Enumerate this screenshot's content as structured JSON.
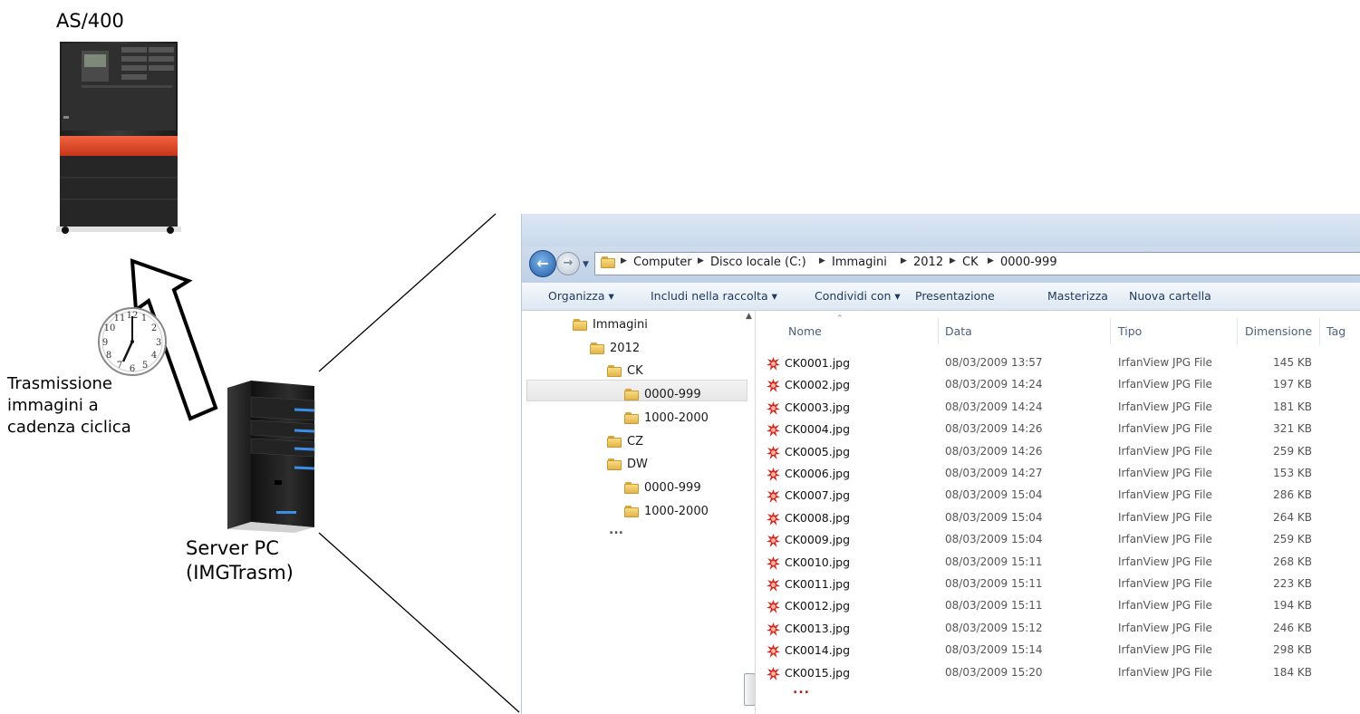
{
  "diagram": {
    "as400_label": "AS/400",
    "transmission_label": [
      "Trasmissione",
      "immagini a",
      "cadenza ciclica"
    ],
    "server_label": [
      "Server PC",
      "(IMGTrasm)"
    ]
  },
  "explorer": {
    "breadcrumb": [
      "Computer",
      "Disco locale (C:)",
      "Immagini",
      "2012",
      "CK",
      "0000-999"
    ],
    "toolbar": [
      "Organizza",
      "Includi nella raccolta",
      "Condividi con",
      "Presentazione",
      "Masterizza",
      "Nuova cartella"
    ],
    "tree": [
      {
        "label": "Immagini",
        "level": 0
      },
      {
        "label": "2012",
        "level": 1
      },
      {
        "label": "CK",
        "level": 2
      },
      {
        "label": "0000-999",
        "level": 3,
        "selected": true
      },
      {
        "label": "1000-2000",
        "level": 3
      },
      {
        "label": "CZ",
        "level": 2
      },
      {
        "label": "DW",
        "level": 2
      },
      {
        "label": "0000-999",
        "level": 3
      },
      {
        "label": "1000-2000",
        "level": 3
      }
    ],
    "tree_more": "...",
    "columns": [
      "Nome",
      "Data",
      "Tipo",
      "Dimensione",
      "Tag"
    ],
    "files": [
      {
        "name": "CK0001.jpg",
        "date": "08/03/2009 13:57",
        "type": "IrfanView JPG File",
        "size": "145 KB"
      },
      {
        "name": "CK0002.jpg",
        "date": "08/03/2009 14:24",
        "type": "IrfanView JPG File",
        "size": "197 KB"
      },
      {
        "name": "CK0003.jpg",
        "date": "08/03/2009 14:24",
        "type": "IrfanView JPG File",
        "size": "181 KB"
      },
      {
        "name": "CK0004.jpg",
        "date": "08/03/2009 14:26",
        "type": "IrfanView JPG File",
        "size": "321 KB"
      },
      {
        "name": "CK0005.jpg",
        "date": "08/03/2009 14:26",
        "type": "IrfanView JPG File",
        "size": "259 KB"
      },
      {
        "name": "CK0006.jpg",
        "date": "08/03/2009 14:27",
        "type": "IrfanView JPG File",
        "size": "153 KB"
      },
      {
        "name": "CK0007.jpg",
        "date": "08/03/2009 15:04",
        "type": "IrfanView JPG File",
        "size": "286 KB"
      },
      {
        "name": "CK0008.jpg",
        "date": "08/03/2009 15:04",
        "type": "IrfanView JPG File",
        "size": "264 KB"
      },
      {
        "name": "CK0009.jpg",
        "date": "08/03/2009 15:04",
        "type": "IrfanView JPG File",
        "size": "259 KB"
      },
      {
        "name": "CK0010.jpg",
        "date": "08/03/2009 15:11",
        "type": "IrfanView JPG File",
        "size": "268 KB"
      },
      {
        "name": "CK0011.jpg",
        "date": "08/03/2009 15:11",
        "type": "IrfanView JPG File",
        "size": "223 KB"
      },
      {
        "name": "CK0012.jpg",
        "date": "08/03/2009 15:11",
        "type": "IrfanView JPG File",
        "size": "194 KB"
      },
      {
        "name": "CK0013.jpg",
        "date": "08/03/2009 15:12",
        "type": "IrfanView JPG File",
        "size": "246 KB"
      },
      {
        "name": "CK0014.jpg",
        "date": "08/03/2009 15:14",
        "type": "IrfanView JPG File",
        "size": "298 KB"
      },
      {
        "name": "CK0015.jpg",
        "date": "08/03/2009 15:20",
        "type": "IrfanView JPG File",
        "size": "184 KB"
      }
    ],
    "files_more": "..."
  },
  "colors": {
    "as400_body": "#2a2a2a",
    "as400_accent": "#e0472a",
    "server_accent": "#3a8ee6",
    "folder": "#e9bd52",
    "file_icon": "#d42b1f",
    "toolbar_text": "#1e395b"
  },
  "icons": [
    "as400-system-icon",
    "server-tower-icon",
    "clock-icon",
    "upload-arrow-icon",
    "back-icon",
    "forward-icon",
    "folder-icon",
    "irfanview-jpg-icon"
  ]
}
